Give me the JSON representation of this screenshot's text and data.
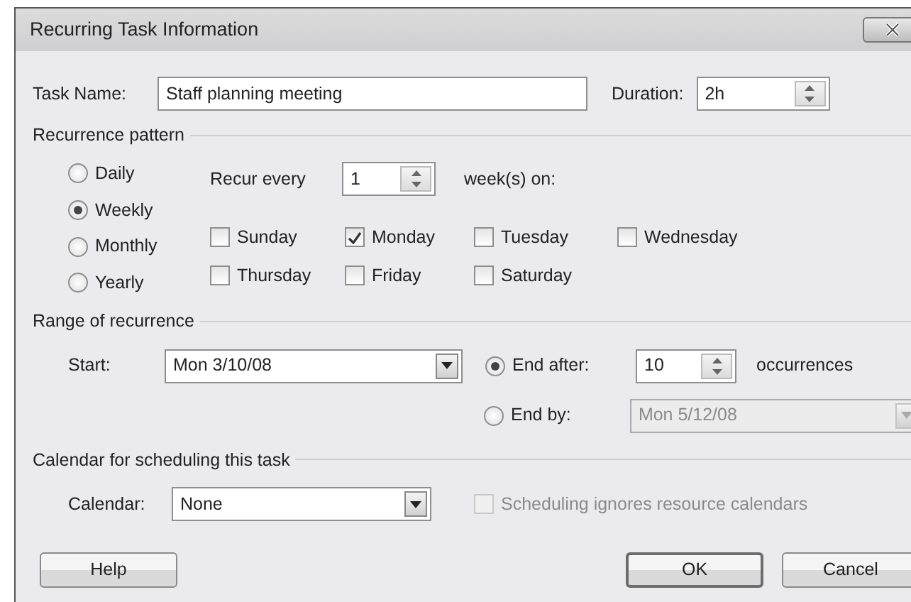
{
  "window": {
    "title": "Recurring Task Information"
  },
  "task": {
    "label": "Task Name:",
    "value": "Staff planning meeting"
  },
  "duration": {
    "label": "Duration:",
    "value": "2h"
  },
  "recurrence": {
    "title": "Recurrence pattern",
    "frequencies": [
      {
        "label": "Daily",
        "selected": false
      },
      {
        "label": "Weekly",
        "selected": true
      },
      {
        "label": "Monthly",
        "selected": false
      },
      {
        "label": "Yearly",
        "selected": false
      }
    ],
    "recur_label": "Recur every",
    "recur_value": "1",
    "unit_label": "week(s) on:",
    "days": [
      {
        "label": "Sunday",
        "checked": false
      },
      {
        "label": "Monday",
        "checked": true
      },
      {
        "label": "Tuesday",
        "checked": false
      },
      {
        "label": "Wednesday",
        "checked": false
      },
      {
        "label": "Thursday",
        "checked": false
      },
      {
        "label": "Friday",
        "checked": false
      },
      {
        "label": "Saturday",
        "checked": false
      }
    ]
  },
  "range": {
    "title": "Range of recurrence",
    "start_label": "Start:",
    "start_value": "Mon 3/10/08",
    "end_after": {
      "label": "End after:",
      "selected": true,
      "value": "10",
      "unit": "occurrences"
    },
    "end_by": {
      "label": "End by:",
      "selected": false,
      "value": "Mon 5/12/08",
      "disabled": true
    }
  },
  "calendar": {
    "title": "Calendar for scheduling this task",
    "label": "Calendar:",
    "value": "None",
    "ignore": {
      "label": "Scheduling ignores resource calendars",
      "checked": false,
      "disabled": true
    }
  },
  "left_buttons": [
    {
      "label": "Help",
      "default": false
    }
  ],
  "right_buttons": [
    {
      "label": "OK",
      "default": true
    },
    {
      "label": "Cancel",
      "default": false
    }
  ]
}
